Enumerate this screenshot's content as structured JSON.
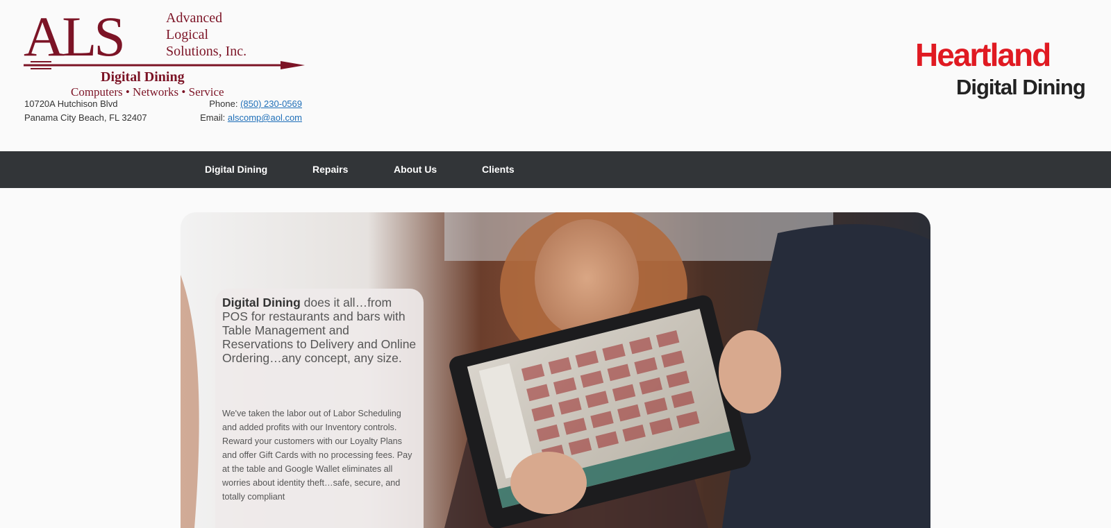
{
  "header": {
    "als_logo": {
      "letters": "ALS",
      "company_lines": [
        "Advanced",
        "Logical",
        "Solutions, Inc."
      ],
      "product": "Digital Dining",
      "tagline": "Computers • Networks • Service"
    },
    "address_line1": "10720A Hutchison Blvd",
    "address_line2": "Panama City Beach, FL 32407",
    "phone_label": "Phone:",
    "phone": "(850) 230-0569",
    "email_label": "Email:",
    "email": "alscomp@aol.com",
    "partner_logo": {
      "word": "Heartland",
      "sub": "Digital Dining"
    }
  },
  "nav": {
    "items": [
      {
        "label": "Digital Dining"
      },
      {
        "label": "Repairs"
      },
      {
        "label": "About Us"
      },
      {
        "label": "Clients"
      }
    ]
  },
  "hero": {
    "headline_bold": "Digital Dining",
    "headline_rest": " does it all…from POS for restaurants and bars with Table Management and Reservations to Delivery and Online Ordering…any concept, any size.",
    "body": "We've taken the labor out of Labor Scheduling and added profits with our Inventory controls. Reward your customers with our Loyalty Plans and offer Gift Cards with no processing fees. Pay at the table and Google Wallet eliminates all worries about identity theft…safe, secure, and totally compliant"
  },
  "colors": {
    "als_maroon": "#7c1426",
    "heartland_red": "#e01a22",
    "nav_bg": "#323538",
    "link": "#1f6fb8"
  }
}
